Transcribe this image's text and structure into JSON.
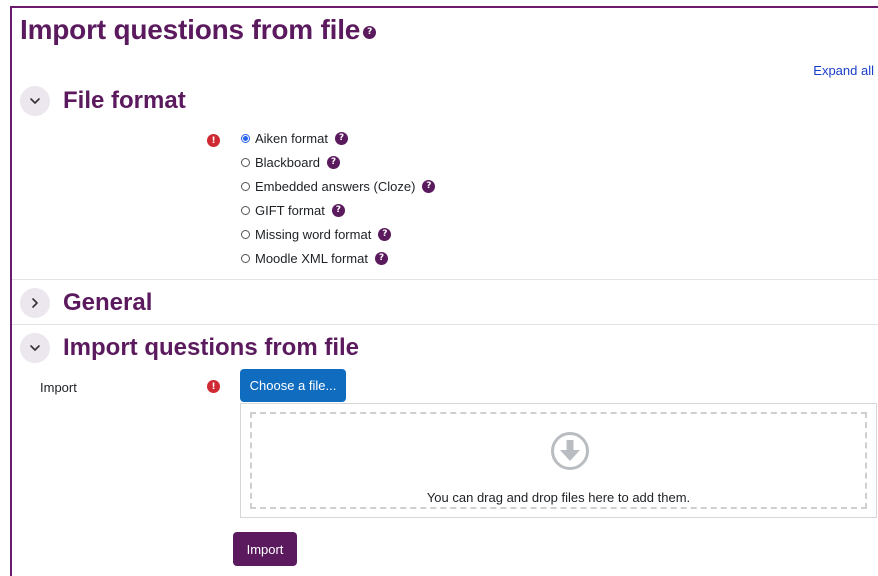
{
  "page": {
    "title": "Import questions from file",
    "expand_all": "Expand all"
  },
  "sections": {
    "file_format": {
      "title": "File format",
      "options": [
        {
          "label": "Aiken format",
          "checked": true
        },
        {
          "label": "Blackboard",
          "checked": false
        },
        {
          "label": "Embedded answers (Cloze)",
          "checked": false
        },
        {
          "label": "GIFT format",
          "checked": false
        },
        {
          "label": "Missing word format",
          "checked": false
        },
        {
          "label": "Moodle XML format",
          "checked": false
        }
      ]
    },
    "general": {
      "title": "General"
    },
    "import": {
      "title": "Import questions from file",
      "field_label": "Import",
      "choose_button": "Choose a file...",
      "drop_text": "You can drag and drop files here to add them."
    }
  },
  "actions": {
    "import_button": "Import"
  },
  "icons": {
    "help": "?",
    "required": "!"
  },
  "colors": {
    "brand": "#5b1a5e",
    "primary": "#0f6cbf",
    "required": "#cf2a33",
    "link": "#1a3ec9"
  }
}
